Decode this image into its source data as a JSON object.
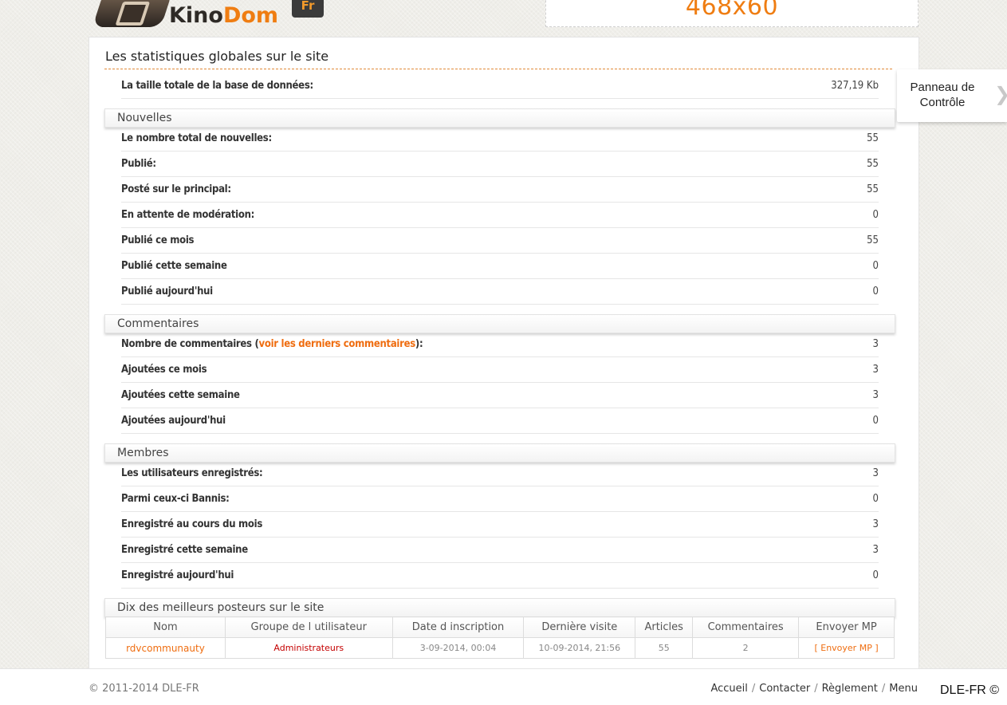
{
  "header": {
    "logo_text_main": "Kino",
    "logo_text_accent": "Dom",
    "logo_badge": "Fr",
    "ad_banner": "468x60"
  },
  "stats": {
    "title": "Les statistiques globales sur le site",
    "db_size_label": "La taille totale de la base de données:",
    "db_size_value": "327,19 Kb",
    "sections": {
      "news": {
        "heading": "Nouvelles",
        "rows": [
          {
            "label": "Le nombre total de nouvelles:",
            "value": "55"
          },
          {
            "label": "Publié:",
            "value": "55"
          },
          {
            "label": "Posté sur le principal:",
            "value": "55"
          },
          {
            "label": "En attente de modération:",
            "value": "0"
          },
          {
            "label": "Publié ce mois",
            "value": "55"
          },
          {
            "label": "Publié cette semaine",
            "value": "0"
          },
          {
            "label": "Publié aujourd'hui",
            "value": "0"
          }
        ]
      },
      "comments": {
        "heading": "Commentaires",
        "first_label_before": "Nombre de commentaires (",
        "first_label_link": "voir les derniers commentaires",
        "first_label_after": "):",
        "first_value": "3",
        "rows": [
          {
            "label": "Ajoutées ce mois",
            "value": "3"
          },
          {
            "label": "Ajoutées cette semaine",
            "value": "3"
          },
          {
            "label": "Ajoutées aujourd'hui",
            "value": "0"
          }
        ]
      },
      "members": {
        "heading": "Membres",
        "rows": [
          {
            "label": "Les utilisateurs enregistrés:",
            "value": "3"
          },
          {
            "label": "Parmi ceux-ci Bannis:",
            "value": "0"
          },
          {
            "label": "Enregistré au cours du mois",
            "value": "3"
          },
          {
            "label": "Enregistré cette semaine",
            "value": "3"
          },
          {
            "label": "Enregistré aujourd'hui",
            "value": "0"
          }
        ]
      },
      "top_posters": {
        "heading": "Dix des meilleurs posteurs sur le site",
        "columns": [
          "Nom",
          "Groupe de l utilisateur",
          "Date d inscription",
          "Dernière visite",
          "Articles",
          "Commentaires",
          "Envoyer MP"
        ],
        "rows": [
          {
            "name": "rdvcommunauty",
            "group": "Administrateurs",
            "registered": "3-09-2014, 00:04",
            "last_visit": "10-09-2014, 21:56",
            "articles": "55",
            "comments": "2",
            "pm": "[ Envoyer MP ]"
          }
        ]
      }
    }
  },
  "side_tab": {
    "label": "Panneau de Contrôle",
    "arrow_icon": "chevron-right-icon"
  },
  "footer": {
    "copyright": "© 2011-2014 DLE-FR",
    "nav": [
      "Accueil",
      "Contacter",
      "Règlement",
      "Menu"
    ],
    "badge": "DLE-FR ©"
  }
}
